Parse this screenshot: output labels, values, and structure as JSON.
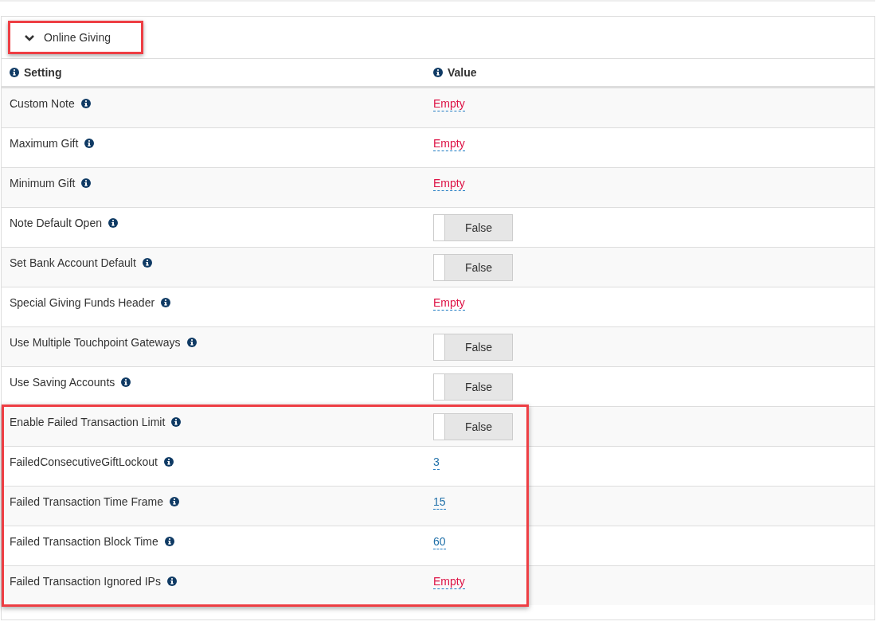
{
  "section": {
    "title": "Online Giving",
    "expanded": true,
    "highlighted": true
  },
  "columns": [
    "Setting",
    "Value"
  ],
  "rows": [
    {
      "setting": "Custom Note",
      "kind": "text",
      "value": "Empty",
      "empty": true,
      "highlighted": false
    },
    {
      "setting": "Maximum Gift",
      "kind": "text",
      "value": "Empty",
      "empty": true,
      "highlighted": false
    },
    {
      "setting": "Minimum Gift",
      "kind": "text",
      "value": "Empty",
      "empty": true,
      "highlighted": false
    },
    {
      "setting": "Note Default Open",
      "kind": "toggle",
      "value": "False",
      "on": false,
      "highlighted": false
    },
    {
      "setting": "Set Bank Account Default",
      "kind": "toggle",
      "value": "False",
      "on": false,
      "highlighted": false
    },
    {
      "setting": "Special Giving Funds Header",
      "kind": "text",
      "value": "Empty",
      "empty": true,
      "highlighted": false
    },
    {
      "setting": "Use Multiple Touchpoint Gateways",
      "kind": "toggle",
      "value": "False",
      "on": false,
      "highlighted": false
    },
    {
      "setting": "Use Saving Accounts",
      "kind": "toggle",
      "value": "False",
      "on": false,
      "highlighted": false
    },
    {
      "setting": "Enable Failed Transaction Limit",
      "kind": "toggle",
      "value": "False",
      "on": false,
      "highlighted": true
    },
    {
      "setting": "FailedConsecutiveGiftLockout",
      "kind": "text",
      "value": "3",
      "empty": false,
      "highlighted": true
    },
    {
      "setting": "Failed Transaction Time Frame",
      "kind": "text",
      "value": "15",
      "empty": false,
      "highlighted": true
    },
    {
      "setting": "Failed Transaction Block Time",
      "kind": "text",
      "value": "60",
      "empty": false,
      "highlighted": true
    },
    {
      "setting": "Failed Transaction Ignored IPs",
      "kind": "text",
      "value": "Empty",
      "empty": true,
      "highlighted": true
    }
  ]
}
